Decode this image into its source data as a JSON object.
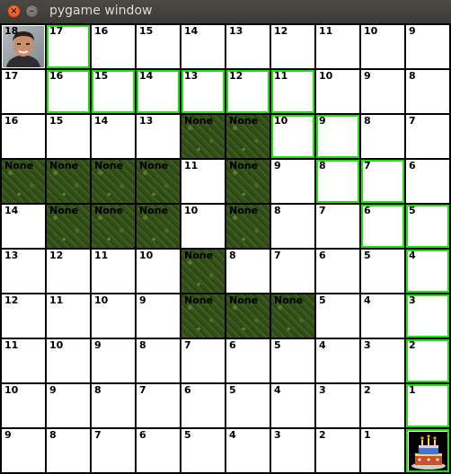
{
  "window": {
    "title": "pygame window",
    "close_glyph": "×",
    "minimize_glyph": "–"
  },
  "grid": {
    "rows": 10,
    "cols": 10,
    "colors": {
      "path": "#22e012",
      "cell": "#ffffff",
      "grid_line": "#000000",
      "obstacle": "#3a5a1c"
    },
    "cells": [
      [
        {
          "label": "18",
          "type": "player",
          "icon": "player-photo"
        },
        {
          "label": "17",
          "type": "path"
        },
        {
          "label": "16",
          "type": "empty"
        },
        {
          "label": "15",
          "type": "empty"
        },
        {
          "label": "14",
          "type": "empty"
        },
        {
          "label": "13",
          "type": "empty"
        },
        {
          "label": "12",
          "type": "empty"
        },
        {
          "label": "11",
          "type": "empty"
        },
        {
          "label": "10",
          "type": "empty"
        },
        {
          "label": "9",
          "type": "empty"
        }
      ],
      [
        {
          "label": "17",
          "type": "empty"
        },
        {
          "label": "16",
          "type": "path"
        },
        {
          "label": "15",
          "type": "path"
        },
        {
          "label": "14",
          "type": "path"
        },
        {
          "label": "13",
          "type": "path"
        },
        {
          "label": "12",
          "type": "path"
        },
        {
          "label": "11",
          "type": "path"
        },
        {
          "label": "10",
          "type": "empty"
        },
        {
          "label": "9",
          "type": "empty"
        },
        {
          "label": "8",
          "type": "empty"
        }
      ],
      [
        {
          "label": "16",
          "type": "empty"
        },
        {
          "label": "15",
          "type": "empty"
        },
        {
          "label": "14",
          "type": "empty"
        },
        {
          "label": "13",
          "type": "empty"
        },
        {
          "label": "None",
          "type": "obstacle"
        },
        {
          "label": "None",
          "type": "obstacle"
        },
        {
          "label": "10",
          "type": "path"
        },
        {
          "label": "9",
          "type": "path"
        },
        {
          "label": "8",
          "type": "empty"
        },
        {
          "label": "7",
          "type": "empty"
        }
      ],
      [
        {
          "label": "None",
          "type": "obstacle"
        },
        {
          "label": "None",
          "type": "obstacle"
        },
        {
          "label": "None",
          "type": "obstacle"
        },
        {
          "label": "None",
          "type": "obstacle"
        },
        {
          "label": "11",
          "type": "empty"
        },
        {
          "label": "None",
          "type": "obstacle"
        },
        {
          "label": "9",
          "type": "empty"
        },
        {
          "label": "8",
          "type": "path"
        },
        {
          "label": "7",
          "type": "path"
        },
        {
          "label": "6",
          "type": "empty"
        }
      ],
      [
        {
          "label": "14",
          "type": "empty"
        },
        {
          "label": "None",
          "type": "obstacle"
        },
        {
          "label": "None",
          "type": "obstacle"
        },
        {
          "label": "None",
          "type": "obstacle"
        },
        {
          "label": "10",
          "type": "empty"
        },
        {
          "label": "None",
          "type": "obstacle"
        },
        {
          "label": "8",
          "type": "empty"
        },
        {
          "label": "7",
          "type": "empty"
        },
        {
          "label": "6",
          "type": "path"
        },
        {
          "label": "5",
          "type": "path"
        }
      ],
      [
        {
          "label": "13",
          "type": "empty"
        },
        {
          "label": "12",
          "type": "empty"
        },
        {
          "label": "11",
          "type": "empty"
        },
        {
          "label": "10",
          "type": "empty"
        },
        {
          "label": "None",
          "type": "obstacle"
        },
        {
          "label": "8",
          "type": "empty"
        },
        {
          "label": "7",
          "type": "empty"
        },
        {
          "label": "6",
          "type": "empty"
        },
        {
          "label": "5",
          "type": "empty"
        },
        {
          "label": "4",
          "type": "path"
        }
      ],
      [
        {
          "label": "12",
          "type": "empty"
        },
        {
          "label": "11",
          "type": "empty"
        },
        {
          "label": "10",
          "type": "empty"
        },
        {
          "label": "9",
          "type": "empty"
        },
        {
          "label": "None",
          "type": "obstacle"
        },
        {
          "label": "None",
          "type": "obstacle"
        },
        {
          "label": "None",
          "type": "obstacle"
        },
        {
          "label": "5",
          "type": "empty"
        },
        {
          "label": "4",
          "type": "empty"
        },
        {
          "label": "3",
          "type": "path"
        }
      ],
      [
        {
          "label": "11",
          "type": "empty"
        },
        {
          "label": "10",
          "type": "empty"
        },
        {
          "label": "9",
          "type": "empty"
        },
        {
          "label": "8",
          "type": "empty"
        },
        {
          "label": "7",
          "type": "empty"
        },
        {
          "label": "6",
          "type": "empty"
        },
        {
          "label": "5",
          "type": "empty"
        },
        {
          "label": "4",
          "type": "empty"
        },
        {
          "label": "3",
          "type": "empty"
        },
        {
          "label": "2",
          "type": "path"
        }
      ],
      [
        {
          "label": "10",
          "type": "empty"
        },
        {
          "label": "9",
          "type": "empty"
        },
        {
          "label": "8",
          "type": "empty"
        },
        {
          "label": "7",
          "type": "empty"
        },
        {
          "label": "6",
          "type": "empty"
        },
        {
          "label": "5",
          "type": "empty"
        },
        {
          "label": "4",
          "type": "empty"
        },
        {
          "label": "3",
          "type": "empty"
        },
        {
          "label": "2",
          "type": "empty"
        },
        {
          "label": "1",
          "type": "path"
        }
      ],
      [
        {
          "label": "9",
          "type": "empty"
        },
        {
          "label": "8",
          "type": "empty"
        },
        {
          "label": "7",
          "type": "empty"
        },
        {
          "label": "6",
          "type": "empty"
        },
        {
          "label": "5",
          "type": "empty"
        },
        {
          "label": "4",
          "type": "empty"
        },
        {
          "label": "3",
          "type": "empty"
        },
        {
          "label": "2",
          "type": "empty"
        },
        {
          "label": "1",
          "type": "empty"
        },
        {
          "label": "",
          "type": "goal",
          "icon": "birthday-cake"
        }
      ]
    ]
  }
}
